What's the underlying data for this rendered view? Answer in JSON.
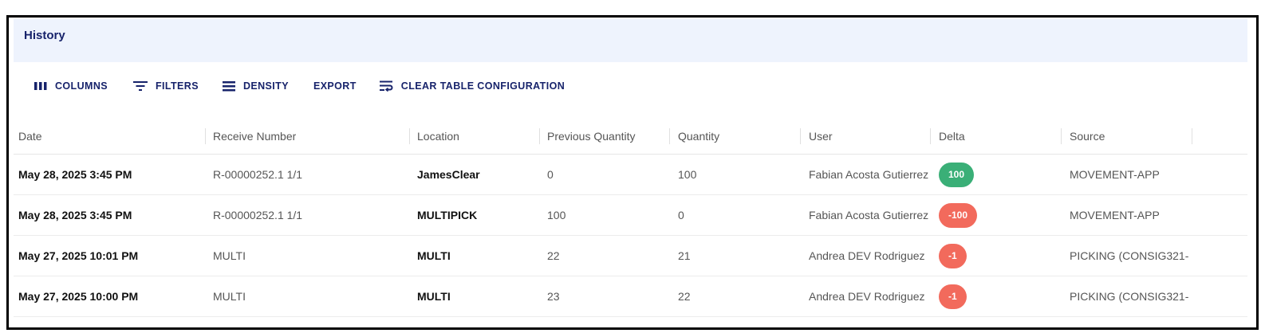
{
  "header": {
    "title": "History"
  },
  "toolbar": {
    "columns": {
      "label": "COLUMNS",
      "icon": "columns-icon"
    },
    "filters": {
      "label": "FILTERS",
      "icon": "filter-icon"
    },
    "density": {
      "label": "DENSITY",
      "icon": "density-icon"
    },
    "export": {
      "label": "EXPORT"
    },
    "clear": {
      "label": "CLEAR TABLE CONFIGURATION",
      "icon": "clear-config-icon"
    }
  },
  "table": {
    "columns": [
      "Date",
      "Receive Number",
      "Location",
      "Previous Quantity",
      "Quantity",
      "User",
      "Delta",
      "Source"
    ],
    "rows": [
      {
        "date": "May 28, 2025 3:45 PM",
        "receive_number": "R-00000252.1 1/1",
        "location": "JamesClear",
        "previous_quantity": "0",
        "quantity": "100",
        "user": "Fabian Acosta Gutierrez",
        "delta": "100",
        "source": "MOVEMENT-APP"
      },
      {
        "date": "May 28, 2025 3:45 PM",
        "receive_number": "R-00000252.1 1/1",
        "location": "MULTIPICK",
        "previous_quantity": "100",
        "quantity": "0",
        "user": "Fabian Acosta Gutierrez",
        "delta": "-100",
        "source": "MOVEMENT-APP"
      },
      {
        "date": "May 27, 2025 10:01 PM",
        "receive_number": "MULTI",
        "location": "MULTI",
        "previous_quantity": "22",
        "quantity": "21",
        "user": "Andrea DEV Rodriguez",
        "delta": "-1",
        "source": "PICKING (CONSIG321-"
      },
      {
        "date": "May 27, 2025 10:00 PM",
        "receive_number": "MULTI",
        "location": "MULTI",
        "previous_quantity": "23",
        "quantity": "22",
        "user": "Andrea DEV Rodriguez",
        "delta": "-1",
        "source": "PICKING (CONSIG321-"
      }
    ]
  },
  "colors": {
    "accent": "#17236b",
    "header_bg": "#eef3fd",
    "delta_positive": "#3aaf77",
    "delta_negative": "#f26a5c"
  }
}
